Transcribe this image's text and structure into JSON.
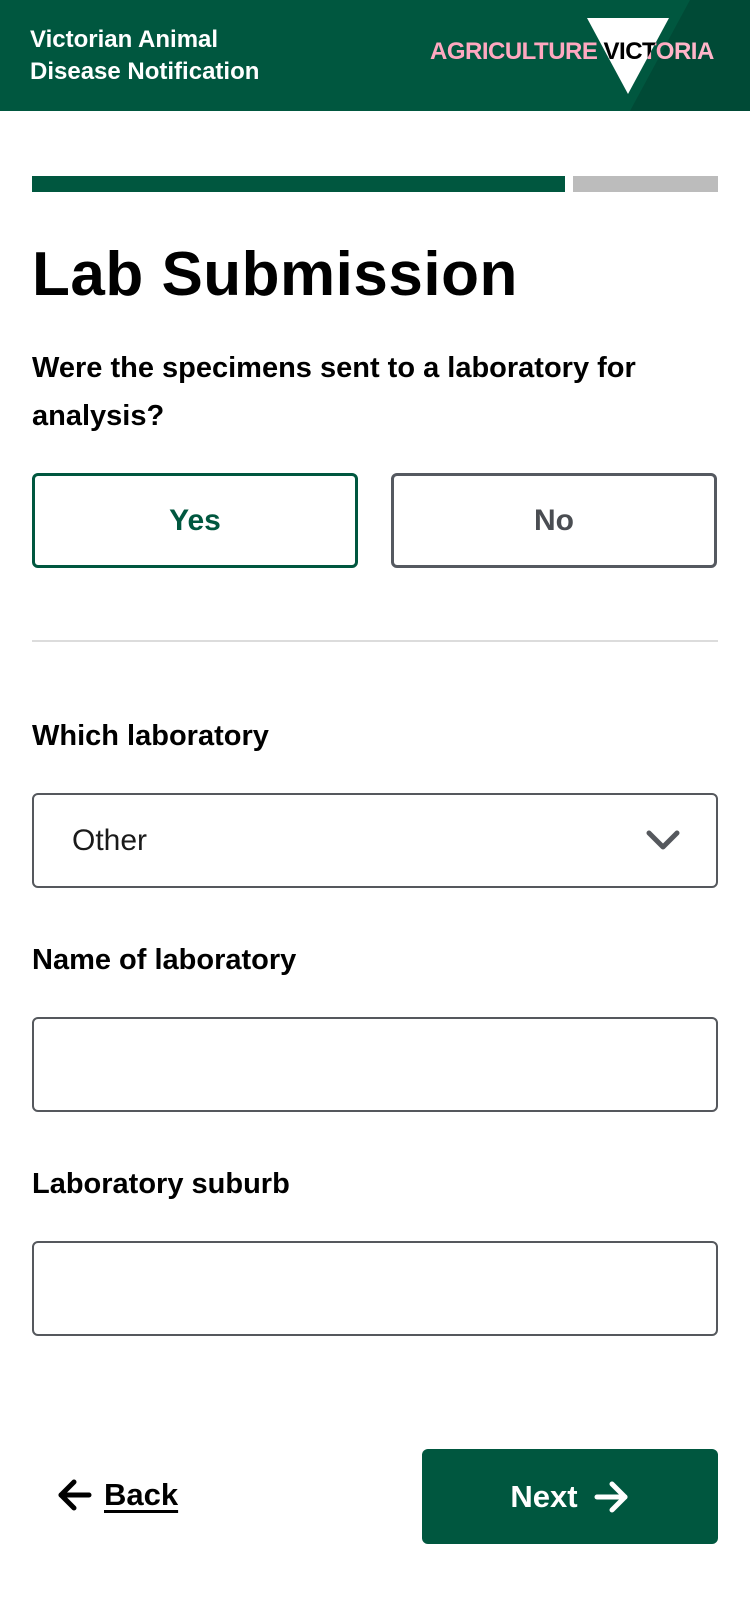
{
  "header": {
    "title_line1": "Victorian Animal",
    "title_line2": "Disease Notification",
    "logo_text": "AGRICULTURE VICTORIA",
    "bg_color": "#00573f"
  },
  "progress": {
    "completed_fraction": 0.8
  },
  "page": {
    "title": "Lab Submission",
    "question": "Were the specimens sent to a laboratory for analysis?",
    "yes_label": "Yes",
    "no_label": "No",
    "selected_answer": "Yes"
  },
  "laboratory": {
    "which_label": "Which laboratory",
    "which_value": "Other",
    "name_label": "Name of laboratory",
    "name_value": "",
    "suburb_label": "Laboratory suburb",
    "suburb_value": ""
  },
  "nav": {
    "back_label": "Back",
    "next_label": "Next"
  },
  "icons": [
    "agriculture-victoria-logo",
    "chevron-down-icon",
    "arrow-left-icon",
    "arrow-right-icon"
  ],
  "colors": {
    "primary": "#00573f",
    "progress_remaining": "#bcbcbc"
  }
}
